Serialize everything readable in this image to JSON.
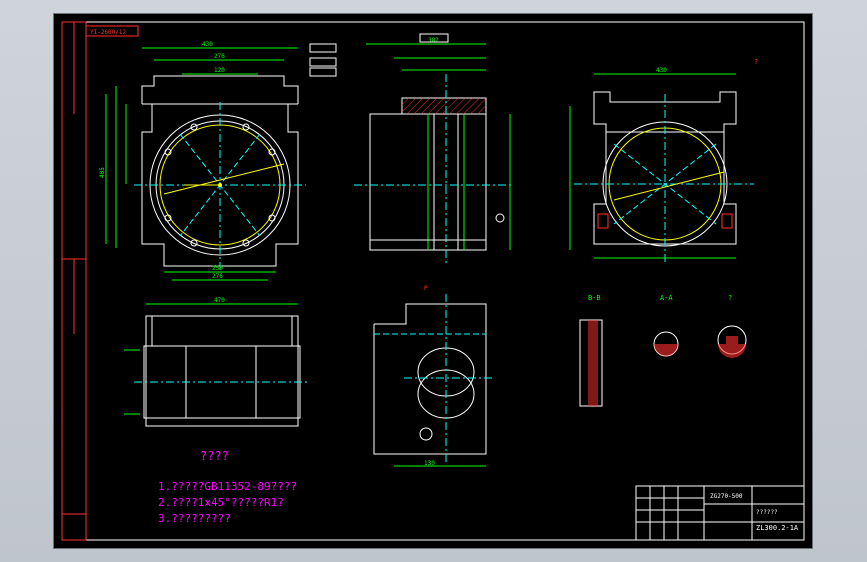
{
  "header_stamp": "YI-2600/12",
  "notes": {
    "title": "????",
    "line1": "1.?????GB11352-89????",
    "line2": "2.????1x45°?????R1?",
    "line3": "3.?????????"
  },
  "title_block": {
    "model": "ZG270-500",
    "name": "??????",
    "drawing_no": "ZL300.2-1A"
  },
  "views": {
    "section_bb": "B-B",
    "section_aa": "A-A",
    "view_question": "?",
    "view_arrow": "P"
  },
  "dimensions": {
    "top_overall": "430",
    "top_inner": "276",
    "top_small": "120",
    "bottom_wide": "276",
    "bottom_small": "250",
    "side_height": "405",
    "bore_top": "382",
    "right_top": "430",
    "bottom_len": "470",
    "bottom_bore": "130"
  },
  "colors": {
    "canvas_bg": "#000000",
    "outline": "#ffffff",
    "dimension": "#00ff00",
    "centerline": "#00ffff",
    "text": "#ffff00",
    "hatch": "#ff3030",
    "accent": "#ff00ff",
    "border": "#ffffff"
  }
}
